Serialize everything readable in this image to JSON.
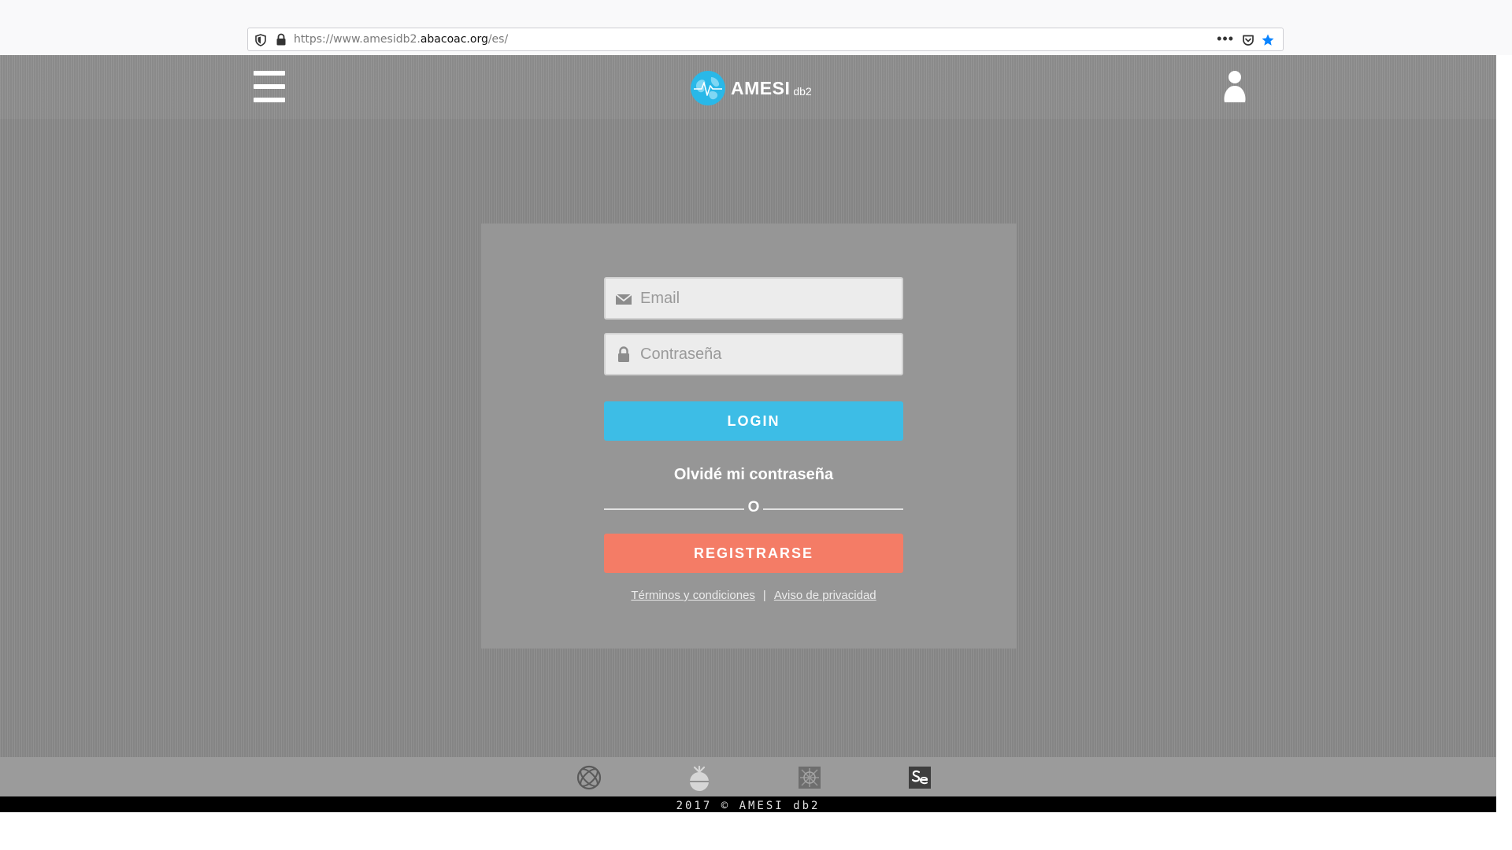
{
  "browser": {
    "url_prefix": "https://www.amesidb2.",
    "url_host": "abacoac.org",
    "url_path": "/es/",
    "menu_dots": "•••"
  },
  "header": {
    "brand": "AMESI",
    "brand_suffix": "db2"
  },
  "login": {
    "email_placeholder": "Email",
    "password_placeholder": "Contraseña",
    "login_label": "LOGIN",
    "forgot_label": "Olvidé mi contraseña",
    "or_label": "O",
    "register_label": "REGISTRARSE",
    "terms_label": "Términos y condiciones",
    "separator": "|",
    "privacy_label": "Aviso de privacidad"
  },
  "footer": {
    "copyright": "2017 © AMESI db2"
  },
  "colors": {
    "login_button": "#3dbde6",
    "register_button": "#f47c66",
    "logo_globe": "#29b8e8",
    "page_background": "#8a8a8a"
  },
  "icons": [
    "shield-icon",
    "lock-icon",
    "pocket-icon",
    "bookmark-star-icon",
    "hamburger-menu-icon",
    "globe-logo-icon",
    "user-icon",
    "mail-icon",
    "padlock-icon",
    "partner-logo-icons"
  ]
}
